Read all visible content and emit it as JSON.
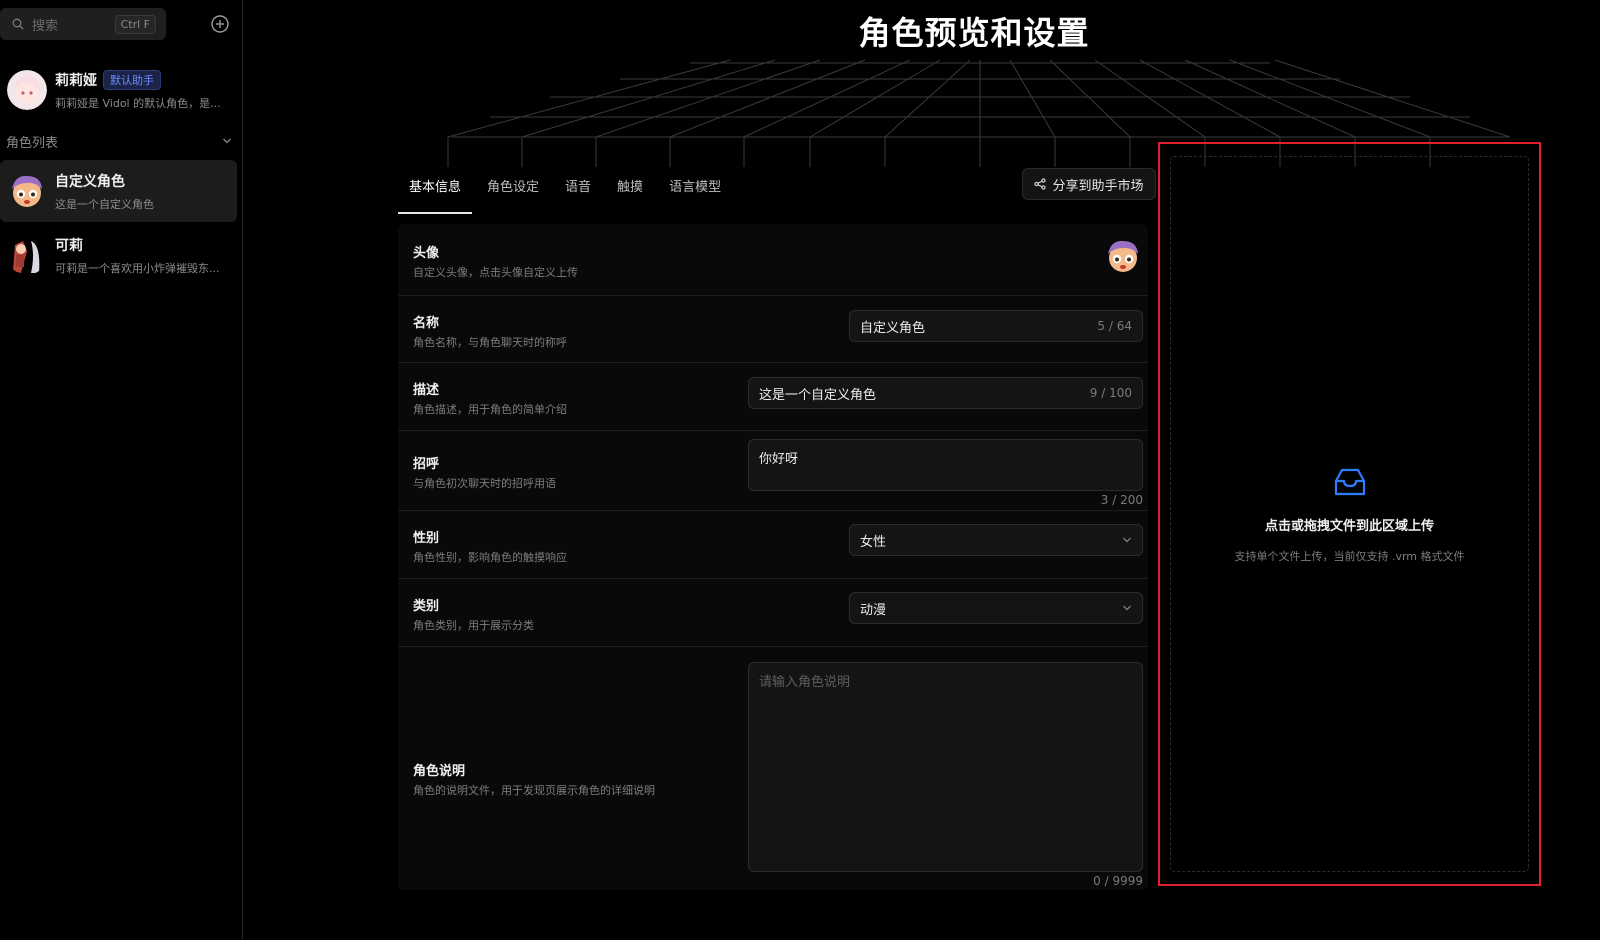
{
  "search": {
    "placeholder": "搜索",
    "shortcut": "Ctrl F"
  },
  "default_role": {
    "name": "莉莉娅",
    "badge": "默认助手",
    "desc": "莉莉娅是 Vidol 的默认角色，是..."
  },
  "role_list": {
    "header": "角色列表",
    "items": [
      {
        "name": "自定义角色",
        "desc": "这是一个自定义角色",
        "active": true
      },
      {
        "name": "可莉",
        "desc": "可莉是一个喜欢用小炸弹摧毁东..."
      }
    ]
  },
  "page_title": "角色预览和设置",
  "tabs": [
    {
      "label": "基本信息",
      "active": true
    },
    {
      "label": "角色设定"
    },
    {
      "label": "语音"
    },
    {
      "label": "触摸"
    },
    {
      "label": "语言模型"
    }
  ],
  "share_button": "分享到助手市场",
  "form": {
    "avatar": {
      "label": "头像",
      "desc": "自定义头像，点击头像自定义上传"
    },
    "name": {
      "label": "名称",
      "desc": "角色名称，与角色聊天时的称呼",
      "value": "自定义角色",
      "count": "5 / 64"
    },
    "description": {
      "label": "描述",
      "desc": "角色描述，用于角色的简单介绍",
      "value": "这是一个自定义角色",
      "count": "9 / 100"
    },
    "greeting": {
      "label": "招呼",
      "desc": "与角色初次聊天时的招呼用语",
      "value": "你好呀",
      "count": "3 / 200"
    },
    "gender": {
      "label": "性别",
      "desc": "角色性别，影响角色的触摸响应",
      "value": "女性"
    },
    "category": {
      "label": "类别",
      "desc": "角色类别，用于展示分类",
      "value": "动漫"
    },
    "readme": {
      "label": "角色说明",
      "desc": "角色的说明文件，用于发现页展示角色的详细说明",
      "placeholder": "请输入角色说明",
      "count": "0 / 9999"
    }
  },
  "upload": {
    "title": "点击或拖拽文件到此区域上传",
    "hint": "支持单个文件上传，当前仅支持 .vrm 格式文件"
  },
  "colors": {
    "accent_blue": "#2f7dff",
    "highlight_red": "#e0202a",
    "badge_blue": "#6f8cff"
  },
  "icons": [
    "search-icon",
    "add-circle-icon",
    "chevron-down-icon",
    "share-icon",
    "inbox-icon"
  ]
}
